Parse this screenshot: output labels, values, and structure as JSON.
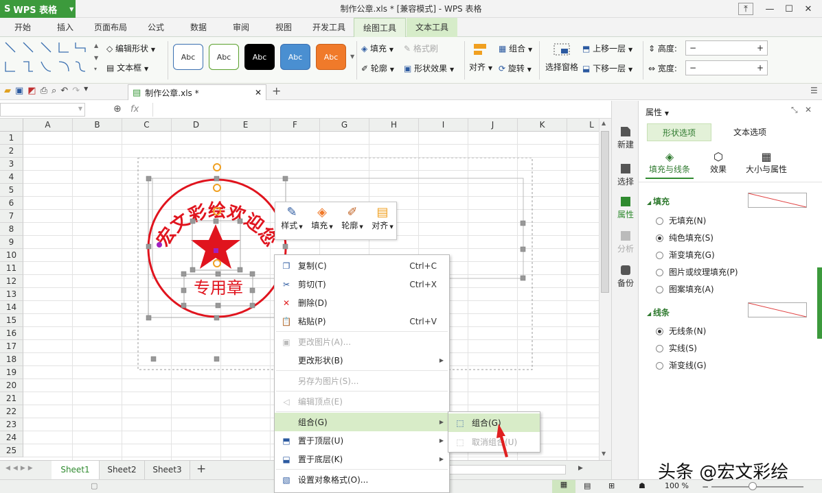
{
  "app": {
    "button_label": "WPS 表格",
    "title": "制作公章.xls * [兼容模式] - WPS 表格"
  },
  "tabs": [
    "开始",
    "插入",
    "页面布局",
    "公式",
    "数据",
    "审阅",
    "视图",
    "开发工具",
    "绘图工具",
    "文本工具"
  ],
  "ribbon": {
    "edit_shape": "编辑形状",
    "text_box": "文本框",
    "style_samples": [
      "Abc",
      "Abc",
      "Abc",
      "Abc",
      "Abc"
    ],
    "fill": "填充",
    "format_painter": "格式刷",
    "outline": "轮廓",
    "shape_effect": "形状效果",
    "align": "对齐",
    "group": "组合",
    "rotate": "旋转",
    "selection_pane": "选择窗格",
    "bring_forward": "上移一层",
    "send_backward": "下移一层",
    "height": "高度:",
    "width": "宽度:"
  },
  "doc_tab": "制作公章.xls *",
  "formula": {
    "fx": "fx"
  },
  "columns": [
    "A",
    "B",
    "C",
    "D",
    "E",
    "F",
    "G",
    "H",
    "I",
    "J",
    "K",
    "L"
  ],
  "rows": [
    "1",
    "2",
    "3",
    "4",
    "5",
    "6",
    "7",
    "8",
    "9",
    "10",
    "11",
    "12",
    "13",
    "14",
    "15",
    "16",
    "17",
    "18",
    "19",
    "20",
    "21",
    "22",
    "23",
    "24",
    "25"
  ],
  "stamp": {
    "arc_text": "宏文彩绘欢迎您",
    "bottom_text": "专用章",
    "color": "#e0141e"
  },
  "minibar": {
    "style": "样式",
    "fill": "填充",
    "outline": "轮廓",
    "align": "对齐"
  },
  "context_menu": [
    {
      "label": "复制(C)",
      "shortcut": "Ctrl+C",
      "icon": "copy-icon"
    },
    {
      "label": "剪切(T)",
      "shortcut": "Ctrl+X",
      "icon": "scissors-icon"
    },
    {
      "label": "删除(D)",
      "shortcut": "",
      "icon": "delete-icon"
    },
    {
      "label": "粘贴(P)",
      "shortcut": "Ctrl+V",
      "icon": "paste-icon"
    },
    {
      "label": "更改图片(A)...",
      "shortcut": "",
      "icon": "image-icon"
    },
    {
      "label": "更改形状(B)",
      "shortcut": "",
      "icon": ""
    },
    {
      "label": "另存为图片(S)...",
      "shortcut": "",
      "icon": ""
    },
    {
      "label": "编辑顶点(E)",
      "shortcut": "",
      "icon": "vertex-icon"
    },
    {
      "label": "组合(G)",
      "shortcut": "",
      "icon": ""
    },
    {
      "label": "置于顶层(U)",
      "shortcut": "",
      "icon": "bring-front-icon"
    },
    {
      "label": "置于底层(K)",
      "shortcut": "",
      "icon": "send-back-icon"
    },
    {
      "label": "设置对象格式(O)...",
      "shortcut": "",
      "icon": "format-icon"
    }
  ],
  "submenu": [
    {
      "label": "组合(G)"
    },
    {
      "label": "取消组合(U)"
    }
  ],
  "sheets": [
    "Sheet1",
    "Sheet2",
    "Sheet3"
  ],
  "side_nav": [
    "新建",
    "选择",
    "属性",
    "分析",
    "备份"
  ],
  "panel": {
    "title": "属性",
    "tabs": [
      "形状选项",
      "文本选项"
    ],
    "subtabs": [
      "填充与线条",
      "效果",
      "大小与属性"
    ],
    "fill_section": "填充",
    "fill_options": [
      "无填充(N)",
      "纯色填充(S)",
      "渐变填充(G)",
      "图片或纹理填充(P)",
      "图案填充(A)"
    ],
    "line_section": "线条",
    "line_options": [
      "无线条(N)",
      "实线(S)",
      "渐变线(G)"
    ]
  },
  "status": {
    "zoom": "100 %"
  },
  "watermark": "头条 @宏文彩绘"
}
